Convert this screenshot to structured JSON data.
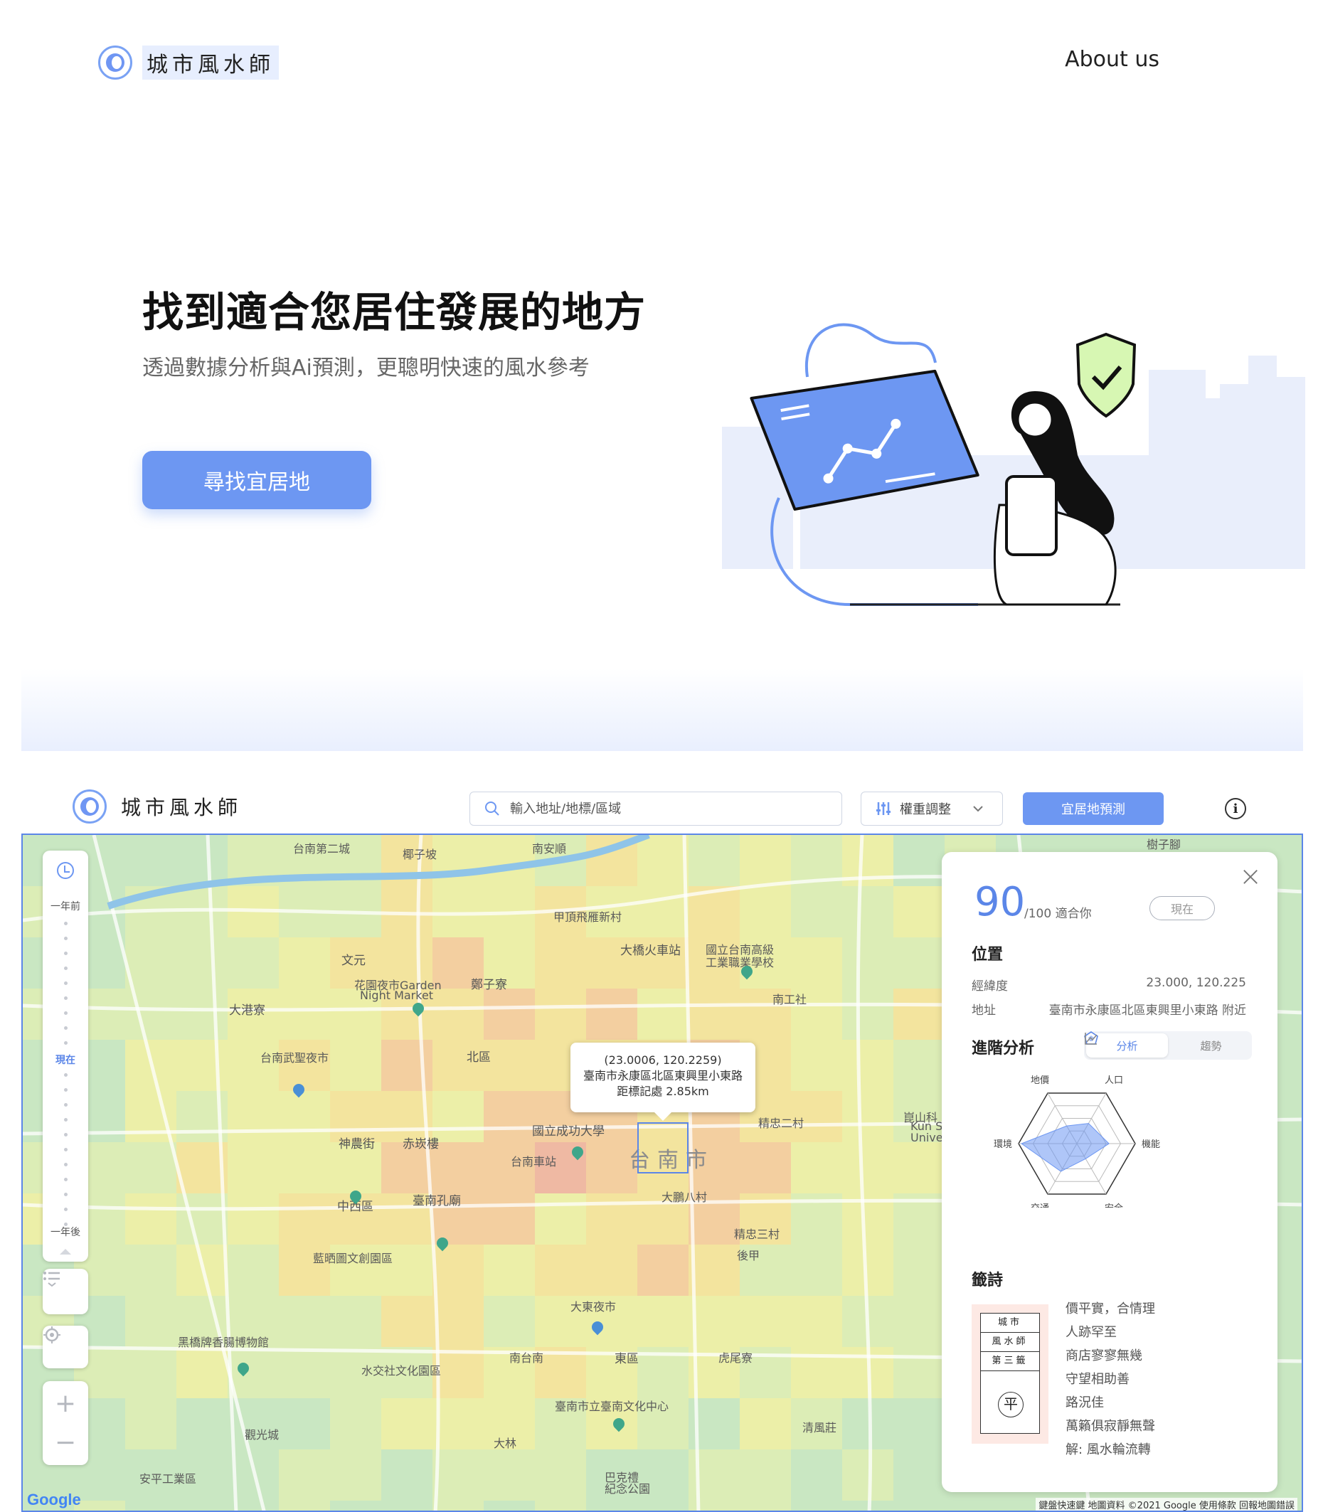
{
  "landing": {
    "brand": "城市風水師",
    "nav_about": "About us",
    "hero_title": "找到適合您居住發展的地方",
    "hero_subtitle": "透過數據分析與Ai預測，更聰明快速的風水參考",
    "hero_button": "尋找宜居地"
  },
  "app": {
    "brand": "城市風水師",
    "search_placeholder": "輸入地址/地標/區域",
    "weight_label": "權重調整",
    "predict_button": "宜居地預測",
    "info_icon": "i"
  },
  "timeline": {
    "top": "一年前",
    "now": "現在",
    "bottom": "一年後"
  },
  "map": {
    "labels": [
      "台南第二城",
      "椰子坡",
      "南安順",
      "樹子腳",
      "大橋火車站",
      "國立台南高級",
      "工業職業學校",
      "文元",
      "花園夜市Garden",
      "Night Market",
      "鄭子寮",
      "大港寮",
      "南工社",
      "北區",
      "台南武聖夜市",
      "國立成功大學",
      "台南車站",
      "精忠二村",
      "崑山科",
      "Kun S",
      "Unive",
      "神農街",
      "赤崁樓",
      "中西區",
      "臺南孔廟",
      "大鵬八村",
      "藍晒圖文創園區",
      "精忠三村",
      "後甲",
      "大東夜市",
      "黑橋牌香腸博物館",
      "水交社文化園區",
      "南台南",
      "東區",
      "虎尾寮",
      "臺南市立臺南文化中心",
      "清風莊",
      "觀光城",
      "大林",
      "安平工業區",
      "巴克禮",
      "紀念公園",
      "甲頂飛雁新村"
    ],
    "district": "台南市",
    "popup": {
      "coords": "(23.0006, 120.2259)",
      "address": "臺南市永康區北區東興里小東路",
      "distance": "距標記處 2.85km"
    },
    "google": "Google",
    "attribution": "鍵盤快速鍵   地圖資料 ©2021 Google   使用條款   回報地圖錯誤"
  },
  "panel": {
    "score": "90",
    "score_suffix": "/100 適合你",
    "badge": "現在",
    "location_title": "位置",
    "coords_label": "經緯度",
    "coords_value": "23.000, 120.225",
    "address_label": "地址",
    "address_value": "臺南市永康區北區東興里小東路 附近",
    "analysis_title": "進階分析",
    "tab_analysis": "分析",
    "tab_trend": "趨勢",
    "radar_axes": [
      "地價",
      "人口",
      "機能",
      "安全",
      "交通",
      "環境"
    ],
    "radar_values": [
      0.35,
      0.4,
      0.55,
      0.3,
      0.55,
      0.95
    ],
    "poem_title": "籤詩",
    "poem_card": {
      "line1": "城市",
      "line2": "風水師",
      "line3": "第三籤",
      "seal": "平"
    },
    "poem_lines": [
      "價平實，合情理",
      "人跡罕至",
      "商店寥寥無幾",
      "守望相助善",
      "路況佳",
      "萬籟俱寂靜無聲",
      "解: 風水輪流轉"
    ]
  },
  "colors": {
    "accent": "#6d97f2",
    "accent_dark": "#5b86e8"
  }
}
